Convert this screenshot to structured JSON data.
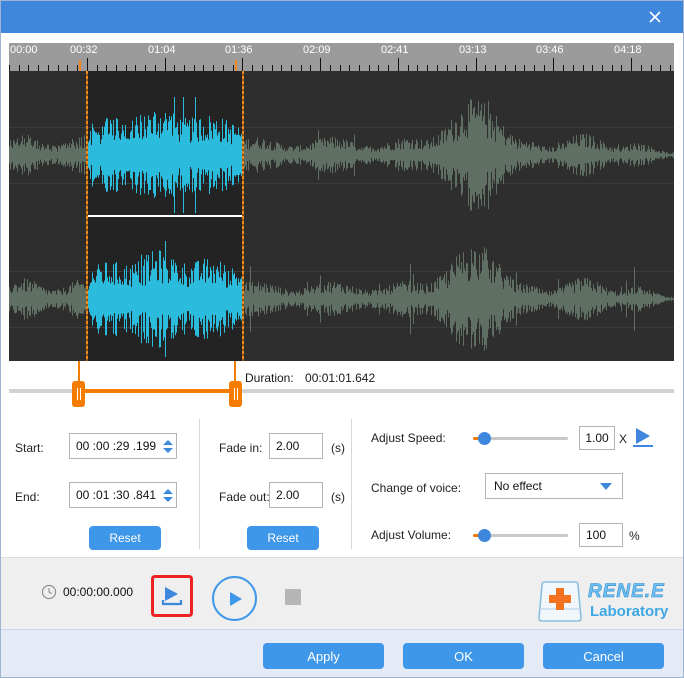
{
  "window": {
    "title": "",
    "close_icon": "close-icon",
    "titlebar_color": "#3e87dd"
  },
  "timeline": {
    "ticks": [
      "00:00",
      "00:32",
      "01:04",
      "01:36",
      "02:09",
      "02:41",
      "03:13",
      "03:46",
      "04:18"
    ],
    "selection_start_label": "00:32",
    "selection_end_label": "01:36",
    "marker_color": "#f08a1c",
    "selected_wave_color": "#2bbcdd",
    "unselected_wave_color": "#5f6f63",
    "background_color": "#2e2e2e"
  },
  "trim": {
    "duration_label": "Duration:",
    "duration_value": "00:01:01.642",
    "handle_color": "#f47c00"
  },
  "controls": {
    "start_label": "Start:",
    "start_value": "00 :00 :29 .199",
    "end_label": "End:",
    "end_value": "00 :01 :30 .841",
    "reset_left_label": "Reset",
    "fade_in_label": "Fade in:",
    "fade_in_value": "2.00",
    "fade_in_unit": "(s)",
    "fade_out_label": "Fade out:",
    "fade_out_value": "2.00",
    "fade_out_unit": "(s)",
    "reset_right_label": "Reset",
    "speed_label": "Adjust Speed:",
    "speed_value": "1.00",
    "speed_unit": "X",
    "speed_percent": 12,
    "voice_label": "Change of voice:",
    "voice_value": "No effect",
    "voice_options": [
      "No effect"
    ],
    "volume_label": "Adjust Volume:",
    "volume_value": "100",
    "volume_unit": "%",
    "volume_percent": 12
  },
  "playback": {
    "clock_icon": "clock-icon",
    "timecode": "00:00:00.000",
    "play_selection_icon": "play-selection-icon",
    "play_icon": "play-icon",
    "stop_icon": "stop-icon",
    "highlight_color": "#ee2222"
  },
  "logo": {
    "line1": "RENE.E",
    "line2": "Laboratory",
    "mark_icon": "plus-key-icon"
  },
  "footer": {
    "apply_label": "Apply",
    "ok_label": "OK",
    "cancel_label": "Cancel",
    "button_color": "#3e97e8"
  }
}
